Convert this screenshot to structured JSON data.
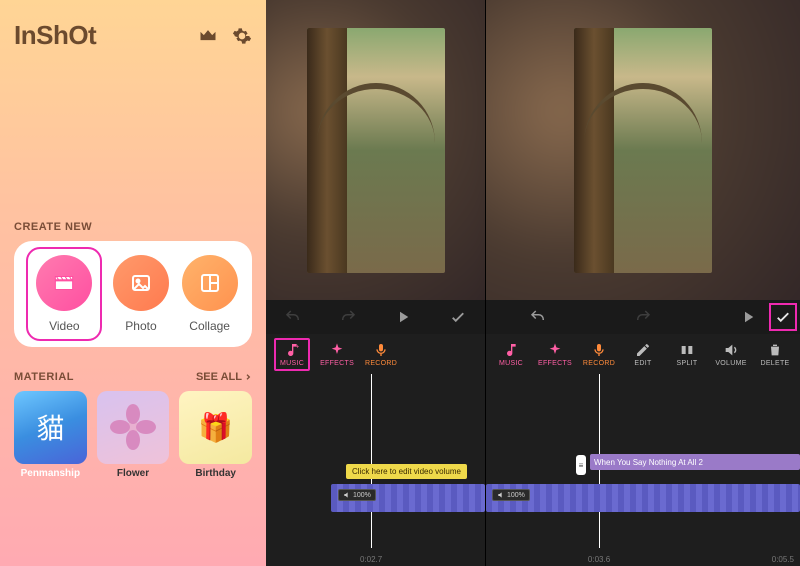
{
  "sidebar": {
    "logo": "InShOt",
    "create_section_label": "CREATE NEW",
    "create_items": [
      {
        "label": "Video"
      },
      {
        "label": "Photo"
      },
      {
        "label": "Collage"
      }
    ],
    "material_section_label": "MATERIAL",
    "see_all": "SEE ALL",
    "material_items": [
      {
        "label": "Penmanship",
        "glyph": "貓"
      },
      {
        "label": "Flower",
        "glyph": "✿"
      },
      {
        "label": "Birthday",
        "glyph": "🎁"
      }
    ]
  },
  "editor": {
    "tool_items_left": [
      {
        "key": "music",
        "label": "MUSIC",
        "color": "pink"
      },
      {
        "key": "effects",
        "label": "EFFECTS",
        "color": "pink"
      },
      {
        "key": "record",
        "label": "RECORD",
        "color": "orange"
      }
    ],
    "tool_items_right": [
      {
        "key": "music",
        "label": "MUSIC",
        "color": "pink"
      },
      {
        "key": "effects",
        "label": "EFFECTS",
        "color": "pink"
      },
      {
        "key": "record",
        "label": "RECORD",
        "color": "orange"
      },
      {
        "key": "edit",
        "label": "EDIT",
        "color": "grey"
      },
      {
        "key": "split",
        "label": "SPLIT",
        "color": "grey"
      },
      {
        "key": "volume",
        "label": "VOLUME",
        "color": "grey"
      },
      {
        "key": "delete",
        "label": "DELETE",
        "color": "grey"
      }
    ],
    "timeline_left": {
      "hint": "Click here to edit video volume",
      "volume_badge": "100%",
      "timecode": "0:02.7",
      "playhead_pct": 48
    },
    "timeline_right": {
      "audio_track": "When You Say Nothing At All 2",
      "volume_badge": "100%",
      "timecodes": [
        "0:03.6",
        "0:05.5"
      ],
      "playhead_pct": 36
    }
  }
}
